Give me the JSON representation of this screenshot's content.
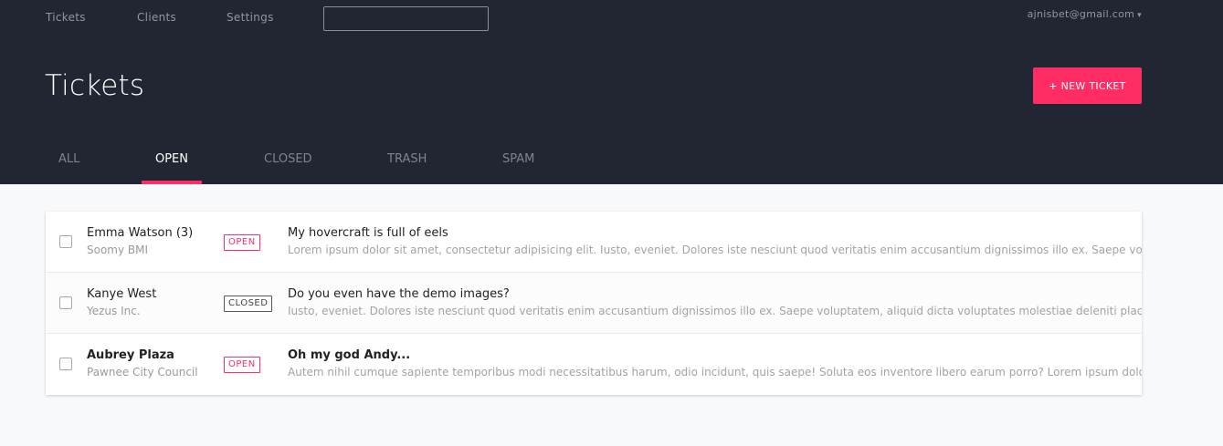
{
  "topnav": {
    "links": [
      "Tickets",
      "Clients",
      "Settings"
    ],
    "search": {
      "value": "",
      "placeholder": ""
    },
    "user_email": "ajnisbet@gmail.com",
    "user_caret": "▾"
  },
  "page": {
    "title": "Tickets",
    "new_ticket_label": "+ NEW TICKET"
  },
  "tabs": [
    {
      "label": "ALL"
    },
    {
      "label": "OPEN",
      "active": true
    },
    {
      "label": "CLOSED"
    },
    {
      "label": "TRASH"
    },
    {
      "label": "SPAM"
    }
  ],
  "tickets": [
    {
      "client_name": "Emma Watson (3)",
      "client_company": "Soomy BMI",
      "status": "OPEN",
      "subject": "My hovercraft is full of eels",
      "preview": "Lorem ipsum dolor sit amet, consectetur adipisicing elit. Iusto, eveniet. Dolores iste nesciunt quod veritatis enim accusantium dignissimos illo ex. Saepe voluptatem, aliquid dicta",
      "unread": false
    },
    {
      "client_name": "Kanye West",
      "client_company": "Yezus Inc.",
      "status": "CLOSED",
      "subject": "Do you even have the demo images?",
      "preview": "Iusto, eveniet. Dolores iste nesciunt quod veritatis enim accusantium dignissimos illo ex. Saepe voluptatem, aliquid dicta voluptates molestiae deleniti placeat ut accusamus.",
      "unread": false
    },
    {
      "client_name": "Aubrey Plaza",
      "client_company": "Pawnee City Council",
      "status": "OPEN",
      "subject": "Oh my god Andy...",
      "preview": "Autem nihil cumque sapiente temporibus modi necessitatibus harum, odio incidunt, quis saepe! Soluta eos inventore libero earum porro? Lorem ipsum dolor sit amet, consectetur",
      "unread": true
    }
  ],
  "colors": {
    "header_bg": "#222633",
    "accent": "#ff2d63",
    "page_bg": "#f8f9fa"
  }
}
